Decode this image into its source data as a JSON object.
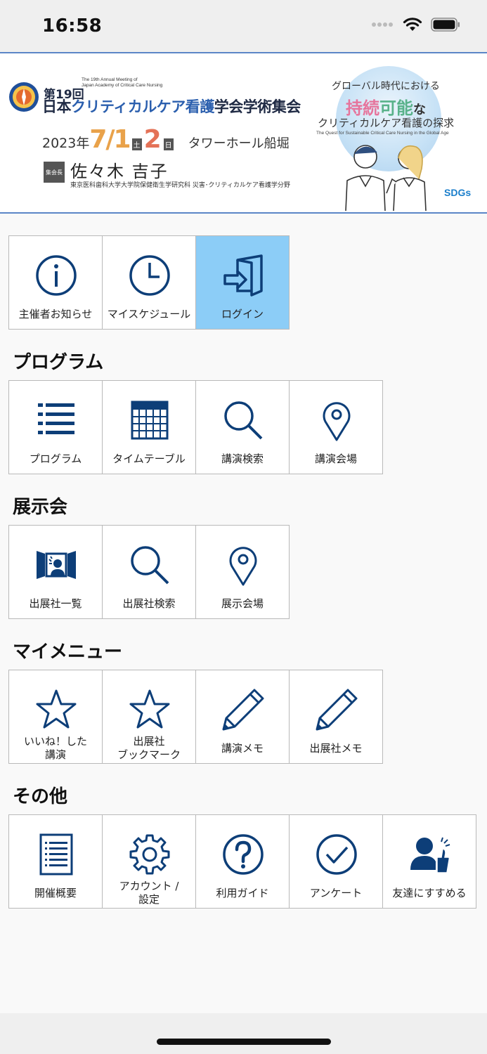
{
  "status_bar": {
    "time": "16:58"
  },
  "banner": {
    "round": "第19回",
    "english_title": "The 19th Annual Meeting of\nJapan Academy of Critical Care Nursing",
    "title_prefix": "日本",
    "title_accent": "クリティカルケア看護",
    "title_suffix": "学会学術集会",
    "year": "2023年",
    "date_start": "7/1",
    "day1": "土",
    "date_end": "2",
    "day2": "日",
    "venue": "タワーホール船堀",
    "chair_label": "集会長",
    "chair_name": "佐々木 吉子",
    "chair_affiliation": "東京医科歯科大学大学院保健衛生学研究科 災害･クリティカルケア看護学分野",
    "catch_line1": "グローバル時代における",
    "catch_line2a": "持続",
    "catch_line2b": "可能",
    "catch_line2c": "な",
    "catch_line3": "クリティカルケア看護の探求",
    "catch_english": "The Quest for Sustainable Critical Care Nursing in the Global Age",
    "sdgs": "SDGs"
  },
  "top_menu": [
    {
      "label": "主催者お知らせ",
      "icon": "info-icon"
    },
    {
      "label": "マイスケジュール",
      "icon": "clock-icon"
    },
    {
      "label": "ログイン",
      "icon": "login-icon",
      "active": true
    }
  ],
  "sections": {
    "program": {
      "title": "プログラム",
      "items": [
        {
          "label": "プログラム",
          "icon": "list-icon"
        },
        {
          "label": "タイムテーブル",
          "icon": "calendar-icon"
        },
        {
          "label": "講演検索",
          "icon": "search-icon"
        },
        {
          "label": "講演会場",
          "icon": "map-pin-icon"
        }
      ]
    },
    "exhibition": {
      "title": "展示会",
      "items": [
        {
          "label": "出展社一覧",
          "icon": "exhibitor-icon"
        },
        {
          "label": "出展社検索",
          "icon": "search-icon"
        },
        {
          "label": "展示会場",
          "icon": "map-pin-icon"
        }
      ]
    },
    "my_menu": {
      "title": "マイメニュー",
      "items": [
        {
          "label": "いいね！した\n講演",
          "icon": "star-icon"
        },
        {
          "label": "出展社\nブックマーク",
          "icon": "star-icon"
        },
        {
          "label": "講演メモ",
          "icon": "pencil-icon"
        },
        {
          "label": "出展社メモ",
          "icon": "pencil-icon"
        }
      ]
    },
    "other": {
      "title": "その他",
      "items": [
        {
          "label": "開催概要",
          "icon": "document-icon"
        },
        {
          "label": "アカウント /\n設定",
          "icon": "gear-icon"
        },
        {
          "label": "利用ガイド",
          "icon": "help-icon"
        },
        {
          "label": "アンケート",
          "icon": "check-circle-icon"
        },
        {
          "label": "友達にすすめる",
          "icon": "recommend-icon"
        }
      ]
    }
  },
  "colors": {
    "icon": "#0d3e78",
    "active_tile": "#8ccdf7",
    "banner_border": "#5b86c7"
  }
}
